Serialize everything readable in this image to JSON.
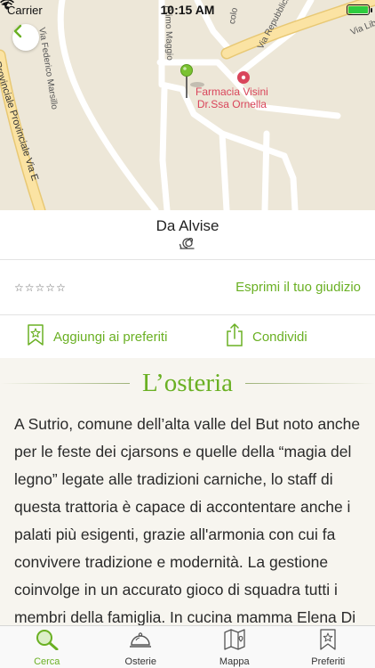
{
  "status_bar": {
    "carrier": "Carrier",
    "time": "10:15 AM",
    "battery_level": 1.0
  },
  "map": {
    "streets": [
      "Via Federico Marsillo",
      "Primo Maggio",
      "Via Repubblica",
      "colo",
      "Via Lib",
      "Provinciale Provinciale Via E"
    ],
    "poi": {
      "icon": "pharmacy-icon",
      "line1": "Farmacia Visini",
      "line2": "Dr.Ssa Ornella"
    },
    "pin_icon": "green-map-pin-icon"
  },
  "venue": {
    "name": "Da Alvise",
    "badge_icon": "snail-icon"
  },
  "rating": {
    "stars": [
      "☆",
      "☆",
      "☆",
      "☆",
      "☆"
    ],
    "value": 0,
    "max": 5,
    "link": "Esprimi il tuo giudizio"
  },
  "actions": {
    "favorite": "Aggiungi ai preferiti",
    "share": "Condividi"
  },
  "article": {
    "title": "L’osteria",
    "text": "A Sutrio, comune dell’alta valle del But noto anche per le feste dei cjarsons e quelle della “magia del legno” legate alle tradizioni carniche, lo staff di questa trattoria è capace di accontentare anche i palati più esigenti, grazie all'armonia con cui fa convivere tradizione e modernità. La gestione coinvolge in un accurato gioco di squadra tutti i membri della famiglia. In cucina mamma Elena Di Ronco ha al suo fianco"
  },
  "tabs": [
    {
      "label": "Cerca",
      "icon": "search-icon",
      "active": true
    },
    {
      "label": "Osterie",
      "icon": "cloche-icon",
      "active": false
    },
    {
      "label": "Mappa",
      "icon": "map-icon",
      "active": false
    },
    {
      "label": "Preferiti",
      "icon": "bookmark-star-icon",
      "active": false
    }
  ],
  "colors": {
    "accent": "#6ab023",
    "map_bg": "#ede7d8",
    "road": "#ffffff",
    "major_road": "#fbe3a3",
    "pharmacy": "#d9455b"
  }
}
